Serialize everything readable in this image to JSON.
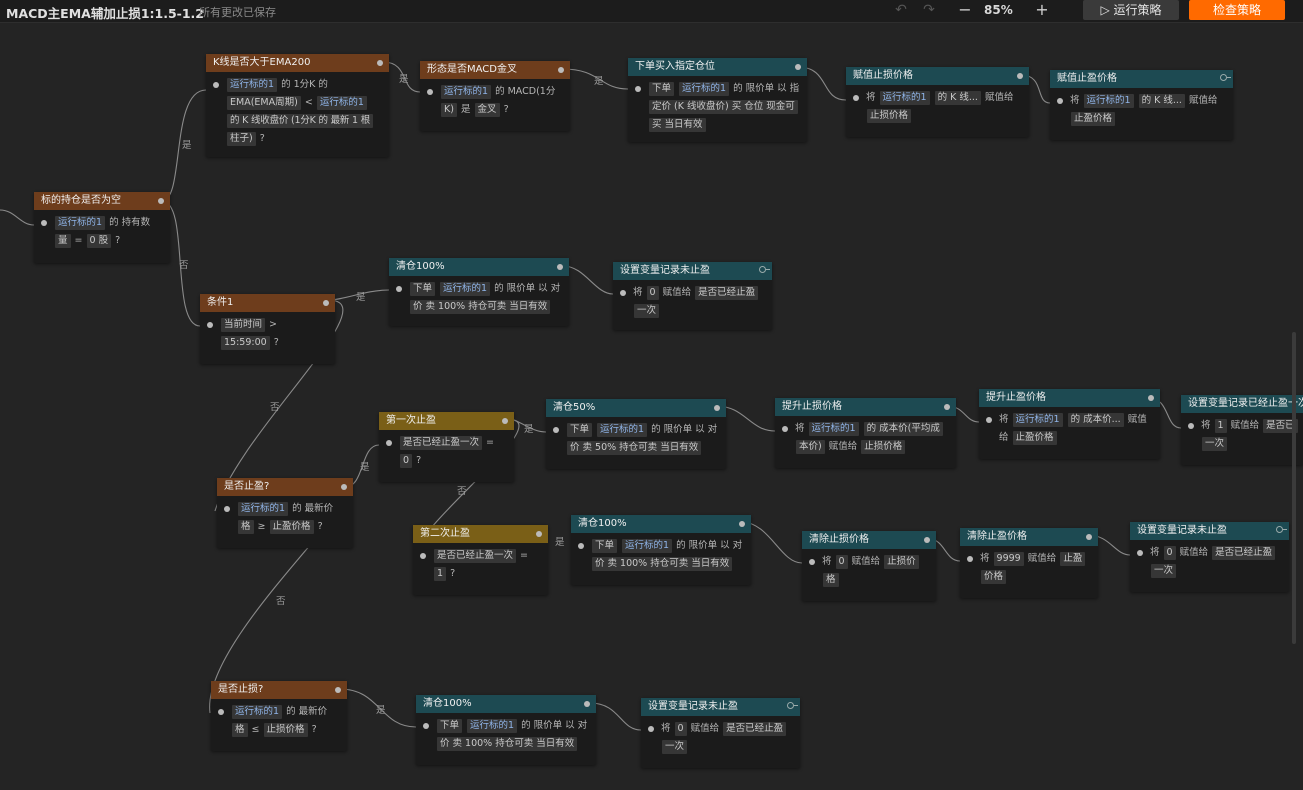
{
  "app": {
    "title": "MACD主EMA辅加止损1:1.5-1.2",
    "saved_status": "所有更改已保存",
    "zoom": "85%",
    "run_label": "运行策略",
    "check_label": "检查策略"
  },
  "labels": {
    "yes": "是",
    "no": "否"
  },
  "nodes": {
    "n1": {
      "title": "标的持仓是否为空",
      "t1": "运行标的1",
      "t2": "的 持有数",
      "t3": "量",
      "t4": "=",
      "t5": "0 股",
      "t6": "?"
    },
    "n2": {
      "title": "K线是否大于EMA200",
      "t1": "运行标的1",
      "t2": "的 1分K 的",
      "t3": "EMA(EMA周期)",
      "t4": "<",
      "t5": "运行标的1",
      "t6": "的 K 线收盘价 (1分K 的 最新 1 根",
      "t7": "柱子)",
      "t8": "?"
    },
    "n3": {
      "title": "形态是否MACD金叉",
      "t1": "运行标的1",
      "t2": "的 MACD(1分",
      "t3": "K)",
      "t4": "是",
      "t5": "金叉",
      "t6": "?"
    },
    "n4": {
      "title": "下单买入指定仓位",
      "t1": "下单",
      "t2": "运行标的1",
      "t3": "的 限价单 以 指",
      "t4": "定价 (K 线收盘价) 买 仓位 现金可",
      "t5": "买 当日有效"
    },
    "n5": {
      "title": "赋值止损价格",
      "t1": "将",
      "t2": "运行标的1",
      "t3": "的 K 线...",
      "t4": "赋值给",
      "t5": "止损价格"
    },
    "n6": {
      "title": "赋值止盈价格",
      "t1": "将",
      "t2": "运行标的1",
      "t3": "的 K 线...",
      "t4": "赋值给",
      "t5": "止盈价格"
    },
    "n7": {
      "title": "条件1",
      "t1": "当前时间",
      "t2": ">",
      "t3": "15:59:00",
      "t4": "?"
    },
    "n8": {
      "title": "清仓100%",
      "t1": "下单",
      "t2": "运行标的1",
      "t3": "的 限价单 以 对",
      "t4": "价 卖 100% 持仓可卖 当日有效"
    },
    "n9": {
      "title": "设置变量记录未止盈",
      "t1": "将",
      "t2": "0",
      "t3": "赋值给",
      "t4": "是否已经止盈",
      "t5": "一次"
    },
    "n10": {
      "title": "是否止盈?",
      "t1": "运行标的1",
      "t2": "的 最新价",
      "t3": "格",
      "t4": "≥",
      "t5": "止盈价格",
      "t6": "?"
    },
    "n11": {
      "title": "第一次止盈",
      "t1": "是否已经止盈一次",
      "t2": "=",
      "t3": "0",
      "t4": "?"
    },
    "n12": {
      "title": "清仓50%",
      "t1": "下单",
      "t2": "运行标的1",
      "t3": "的 限价单 以 对",
      "t4": "价 卖 50% 持仓可卖 当日有效"
    },
    "n13": {
      "title": "提升止损价格",
      "t1": "将",
      "t2": "运行标的1",
      "t3": "的 成本价(平均成",
      "t4": "本价)",
      "t5": "赋值给",
      "t6": "止损价格"
    },
    "n14": {
      "title": "提升止盈价格",
      "t1": "将",
      "t2": "运行标的1",
      "t3": "的 成本价...",
      "t4": "赋值",
      "t5": "给",
      "t6": "止盈价格"
    },
    "n15": {
      "title": "设置变量记录已经止盈一次",
      "t1": "将",
      "t2": "1",
      "t3": "赋值给",
      "t4": "是否已",
      "t5": "一次"
    },
    "n16": {
      "title": "第二次止盈",
      "t1": "是否已经止盈一次",
      "t2": "=",
      "t3": "1",
      "t4": "?"
    },
    "n17": {
      "title": "清仓100%",
      "t1": "下单",
      "t2": "运行标的1",
      "t3": "的 限价单 以 对",
      "t4": "价 卖 100% 持仓可卖 当日有效"
    },
    "n18": {
      "title": "清除止损价格",
      "t1": "将",
      "t2": "0",
      "t3": "赋值给",
      "t4": "止损价",
      "t5": "格"
    },
    "n19": {
      "title": "清除止盈价格",
      "t1": "将",
      "t2": "9999",
      "t3": "赋值给",
      "t4": "止盈",
      "t5": "价格"
    },
    "n20": {
      "title": "设置变量记录未止盈",
      "t1": "将",
      "t2": "0",
      "t3": "赋值给",
      "t4": "是否已经止盈",
      "t5": "一次"
    },
    "n21": {
      "title": "是否止损?",
      "t1": "运行标的1",
      "t2": "的 最新价",
      "t3": "格",
      "t4": "≤",
      "t5": "止损价格",
      "t6": "?"
    },
    "n22": {
      "title": "清仓100%",
      "t1": "下单",
      "t2": "运行标的1",
      "t3": "的 限价单 以 对",
      "t4": "价 卖 100% 持仓可卖 当日有效"
    },
    "n23": {
      "title": "设置变量记录未止盈",
      "t1": "将",
      "t2": "0",
      "t3": "赋值给",
      "t4": "是否已经止盈",
      "t5": "一次"
    }
  }
}
